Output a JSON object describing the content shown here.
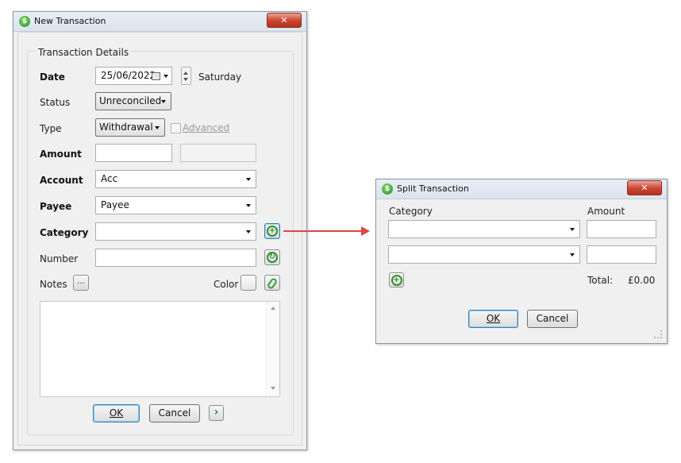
{
  "new_transaction": {
    "window_title": "New Transaction",
    "close_glyph": "✕",
    "app_icon_glyph": "$",
    "group_title": "Transaction Details",
    "date": {
      "label": "Date",
      "value": "25/06/2022",
      "weekday": "Saturday"
    },
    "status": {
      "label": "Status",
      "value": "Unreconciled"
    },
    "type": {
      "label": "Type",
      "value": "Withdrawal",
      "advanced_label": "Advanced",
      "advanced_checked": false
    },
    "amount": {
      "label": "Amount",
      "value": "",
      "secondary_value": ""
    },
    "account": {
      "label": "Account",
      "value": "Acc"
    },
    "payee": {
      "label": "Payee",
      "value": "Payee"
    },
    "category": {
      "label": "Category",
      "value": ""
    },
    "number": {
      "label": "Number",
      "value": ""
    },
    "notes": {
      "label": "Notes",
      "ellipsis": "...",
      "value": ""
    },
    "color": {
      "label": "Color"
    },
    "buttons": {
      "ok": "OK",
      "cancel": "Cancel",
      "next_glyph": "›"
    }
  },
  "split_transaction": {
    "window_title": "Split Transaction",
    "close_glyph": "✕",
    "app_icon_glyph": "$",
    "headers": {
      "category": "Category",
      "amount": "Amount"
    },
    "rows": [
      {
        "category": "",
        "amount": ""
      },
      {
        "category": "",
        "amount": ""
      }
    ],
    "total_label": "Total:",
    "total_value": "£0.00",
    "buttons": {
      "ok": "OK",
      "cancel": "Cancel"
    }
  },
  "colors": {
    "accent_arrow": "#d94a44",
    "icon_green": "#2f8f2a",
    "close_red": "#c9432e"
  },
  "icons": [
    "app-icon",
    "calendar-icon",
    "spin-up-icon",
    "spin-down-icon",
    "add-split-icon",
    "auto-number-icon",
    "attach-icon",
    "close-icon",
    "chevron-right-icon"
  ]
}
